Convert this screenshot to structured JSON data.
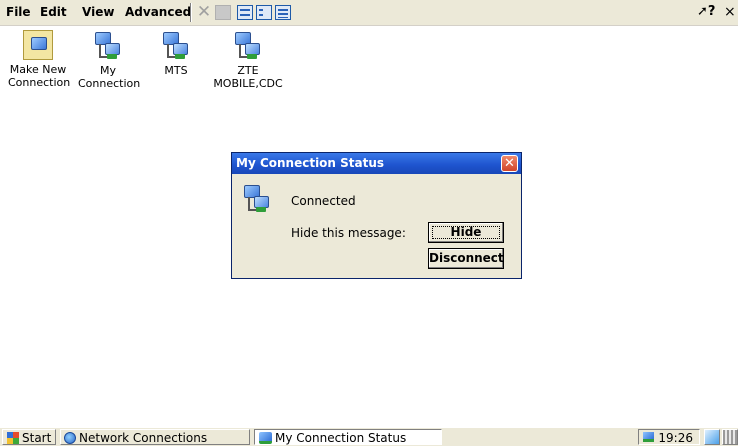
{
  "menu": {
    "items": [
      "File",
      "Edit",
      "View",
      "Advanced"
    ],
    "help_glyph": "?",
    "close_glyph": "×"
  },
  "toolbar": {
    "icons": [
      "delete-icon",
      "properties-icon",
      "large-icons-view-icon",
      "small-icons-view-icon",
      "details-view-icon"
    ]
  },
  "desktop": {
    "icons": [
      {
        "label_line1": "Make New",
        "label_line2": "Connection"
      },
      {
        "label_line1": "My",
        "label_line2": "Connection"
      },
      {
        "label_line1": "MTS",
        "label_line2": ""
      },
      {
        "label_line1": "ZTE",
        "label_line2": "MOBILE,CDC"
      }
    ]
  },
  "dialog": {
    "title": "My Connection Status",
    "status": "Connected",
    "hide_label": "Hide this message:",
    "hide_button": "Hide",
    "disconnect_button": "Disconnect"
  },
  "taskbar": {
    "start": "Start",
    "tasks": [
      "Network Connections",
      "My Connection Status"
    ],
    "clock": "19:26"
  },
  "colors": {
    "title_bar": "#1f55d0",
    "face": "#ece9d8",
    "close_red": "#d0452a"
  }
}
